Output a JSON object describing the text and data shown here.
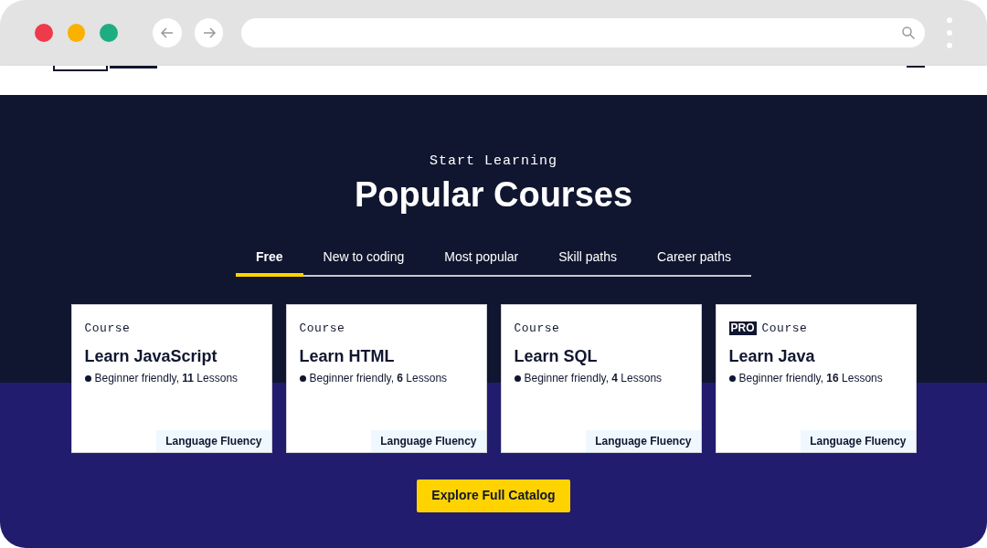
{
  "hero": {
    "eyebrow": "Start Learning",
    "title": "Popular Courses"
  },
  "tabs": [
    {
      "label": "Free",
      "selected": true
    },
    {
      "label": "New to coding",
      "selected": false
    },
    {
      "label": "Most popular",
      "selected": false
    },
    {
      "label": "Skill paths",
      "selected": false
    },
    {
      "label": "Career paths",
      "selected": false
    }
  ],
  "courses": [
    {
      "pro": false,
      "type": "Course",
      "title": "Learn JavaScript",
      "meta": "Beginner friendly, **11** Lessons",
      "tag": "Language Fluency"
    },
    {
      "pro": false,
      "type": "Course",
      "title": "Learn HTML",
      "meta": "Beginner friendly, **6** Lessons",
      "tag": "Language Fluency"
    },
    {
      "pro": false,
      "type": "Course",
      "title": "Learn SQL",
      "meta": "Beginner friendly, **4** Lessons",
      "tag": "Language Fluency"
    },
    {
      "pro": true,
      "pro_label": "PRO",
      "type": "Course",
      "title": "Learn Java",
      "meta": "Beginner friendly, **16** Lessons",
      "tag": "Language Fluency"
    }
  ],
  "cta": "Explore Full Catalog"
}
